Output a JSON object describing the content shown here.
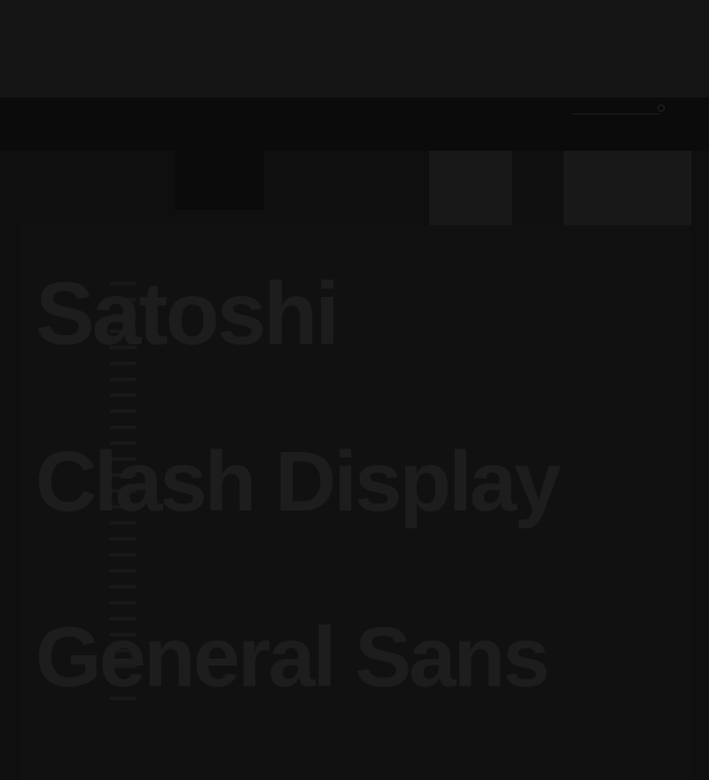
{
  "fonts": [
    {
      "name": "Satoshi"
    },
    {
      "name": "Clash Display"
    },
    {
      "name": "General Sans"
    }
  ],
  "colors": {
    "background": "#0f0f0f",
    "overlay": "#111111",
    "heading": "#1d1d1d"
  }
}
